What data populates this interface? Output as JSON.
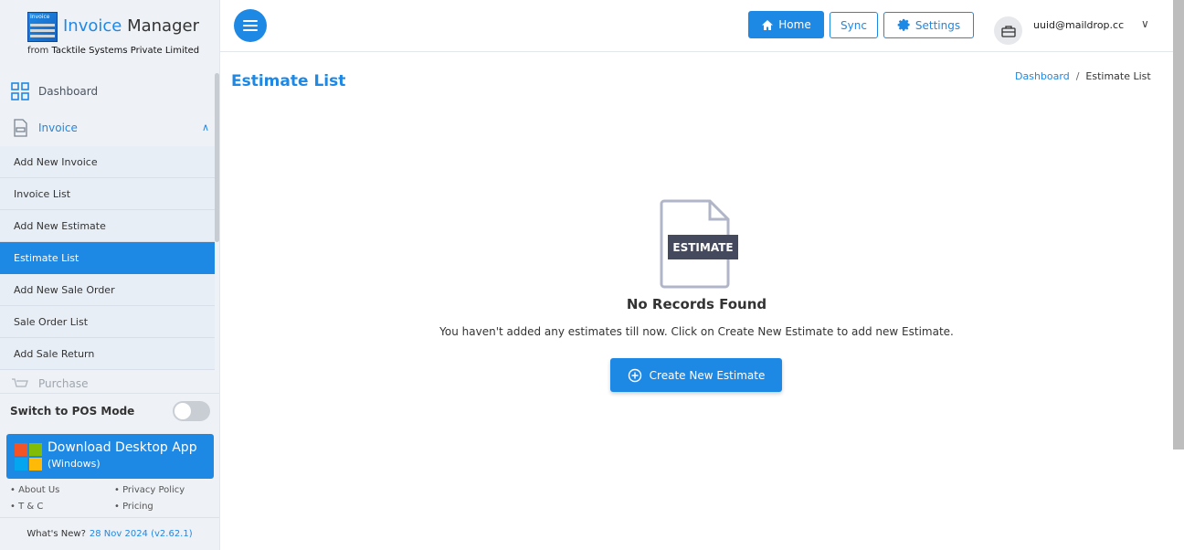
{
  "brand": {
    "logo_tag": "Invoice",
    "title_highlight": "Invoice",
    "title_rest": " Manager",
    "sub_prefix": "from ",
    "company": "Tacktile Systems Private Limited"
  },
  "sidebar": {
    "dashboard": {
      "label": "Dashboard",
      "icon": "grid-icon"
    },
    "invoice": {
      "label": "Invoice",
      "icon": "invoice-icon"
    },
    "invoice_items": [
      {
        "label": "Add New Invoice",
        "active": false
      },
      {
        "label": "Invoice List",
        "active": false
      },
      {
        "label": "Add New Estimate",
        "active": false
      },
      {
        "label": "Estimate List",
        "active": true
      },
      {
        "label": "Add New Sale Order",
        "active": false
      },
      {
        "label": "Sale Order List",
        "active": false
      },
      {
        "label": "Add Sale Return",
        "active": false
      }
    ],
    "purchase": {
      "label": "Purchase",
      "icon": "purchase-icon"
    },
    "pos_mode": {
      "label": "Switch to POS Mode",
      "on": false
    },
    "download": {
      "title": "Download Desktop App",
      "subtitle": "(Windows)"
    },
    "footer_links": [
      "About Us",
      "Privacy Policy",
      "T & C",
      "Pricing"
    ],
    "whats_new": {
      "label": "What's New?",
      "version": "28 Nov 2024 (v2.62.1)"
    }
  },
  "header": {
    "home_label": "Home",
    "sync_label": "Sync",
    "settings_label": "Settings",
    "user_email": "uuid@maildrop.cc"
  },
  "main": {
    "page_title": "Estimate List",
    "breadcrumb": {
      "root": "Dashboard",
      "separator": "/",
      "current": "Estimate List"
    },
    "empty": {
      "icon_label": "ESTIMATE",
      "title": "No Records Found",
      "message": "You haven't added any estimates till now. Click on Create New Estimate to add new Estimate.",
      "button_label": "Create New Estimate"
    }
  },
  "colors": {
    "accent": "#1e88e5",
    "sidebar_bg": "#eef1f6",
    "icon_dark": "#44495e"
  }
}
